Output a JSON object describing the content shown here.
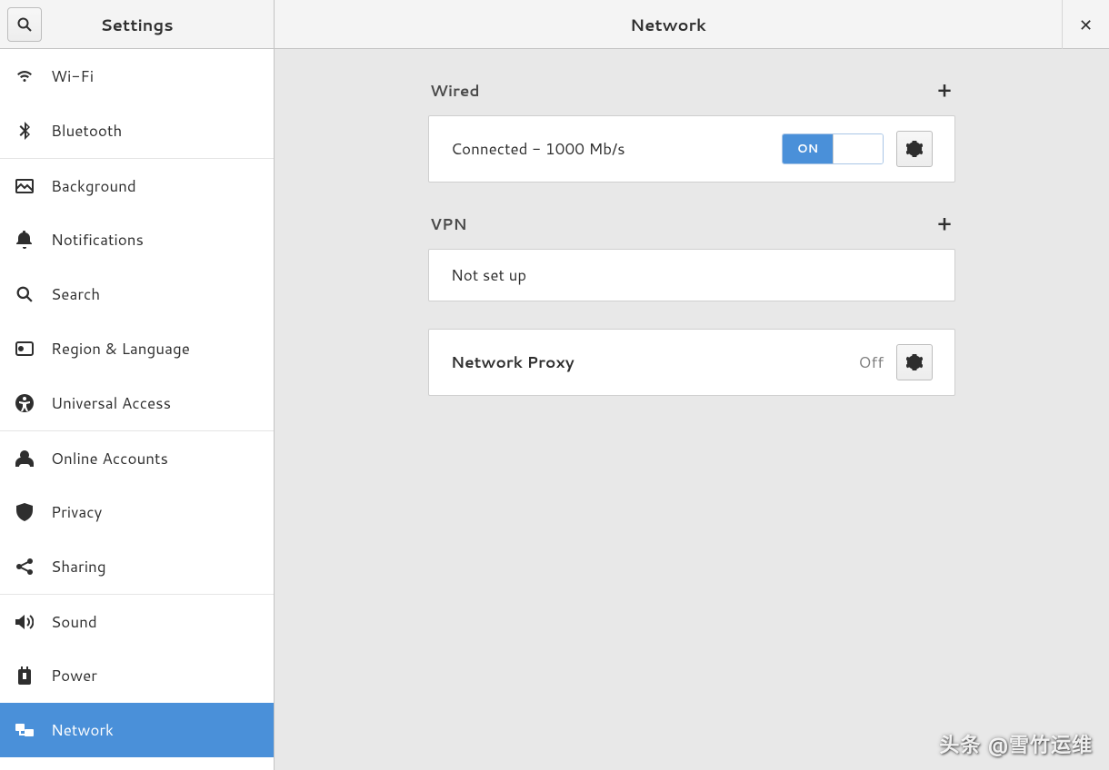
{
  "sidebar": {
    "title": "Settings",
    "items": [
      {
        "label": "Wi-Fi",
        "icon": "wifi"
      },
      {
        "label": "Bluetooth",
        "icon": "bluetooth"
      },
      {
        "label": "Background",
        "icon": "background"
      },
      {
        "label": "Notifications",
        "icon": "bell"
      },
      {
        "label": "Search",
        "icon": "search"
      },
      {
        "label": "Region & Language",
        "icon": "region"
      },
      {
        "label": "Universal Access",
        "icon": "accessibility"
      },
      {
        "label": "Online Accounts",
        "icon": "online"
      },
      {
        "label": "Privacy",
        "icon": "privacy"
      },
      {
        "label": "Sharing",
        "icon": "sharing"
      },
      {
        "label": "Sound",
        "icon": "sound"
      },
      {
        "label": "Power",
        "icon": "power"
      },
      {
        "label": "Network",
        "icon": "network",
        "selected": true
      }
    ]
  },
  "main": {
    "title": "Network"
  },
  "wired": {
    "section_title": "Wired",
    "status": "Connected - 1000 Mb/s",
    "toggle": "ON"
  },
  "vpn": {
    "section_title": "VPN",
    "status": "Not set up"
  },
  "proxy": {
    "title": "Network Proxy",
    "status": "Off"
  },
  "watermark": "头条 @雪竹运维"
}
